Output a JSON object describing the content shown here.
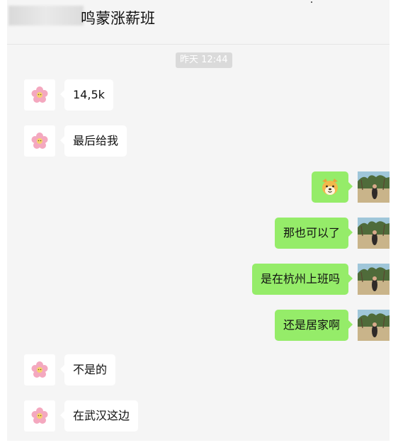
{
  "chat": {
    "title": "鸣蒙涨薪班",
    "timestamp": "昨天 12:44"
  },
  "messages": [
    {
      "side": "in",
      "text": "14,5k"
    },
    {
      "side": "in",
      "text": "最后给我"
    },
    {
      "side": "out",
      "emoji": "dog-face-emoji"
    },
    {
      "side": "out",
      "text": "那也可以了"
    },
    {
      "side": "out",
      "text": "是在杭州上班吗"
    },
    {
      "side": "out",
      "text": "还是居家啊"
    },
    {
      "side": "in",
      "text": "不是的"
    },
    {
      "side": "in",
      "text": "在武汉这边"
    }
  ],
  "colors": {
    "outgoing_bubble": "#95ec69",
    "incoming_bubble": "#ffffff",
    "chat_background": "#f5f5f5"
  },
  "icons": {
    "incoming_avatar": "pink-flower-avatar",
    "outgoing_avatar": "beach-palm-tree-photo-avatar",
    "sticker": "dog-face-emoji"
  }
}
